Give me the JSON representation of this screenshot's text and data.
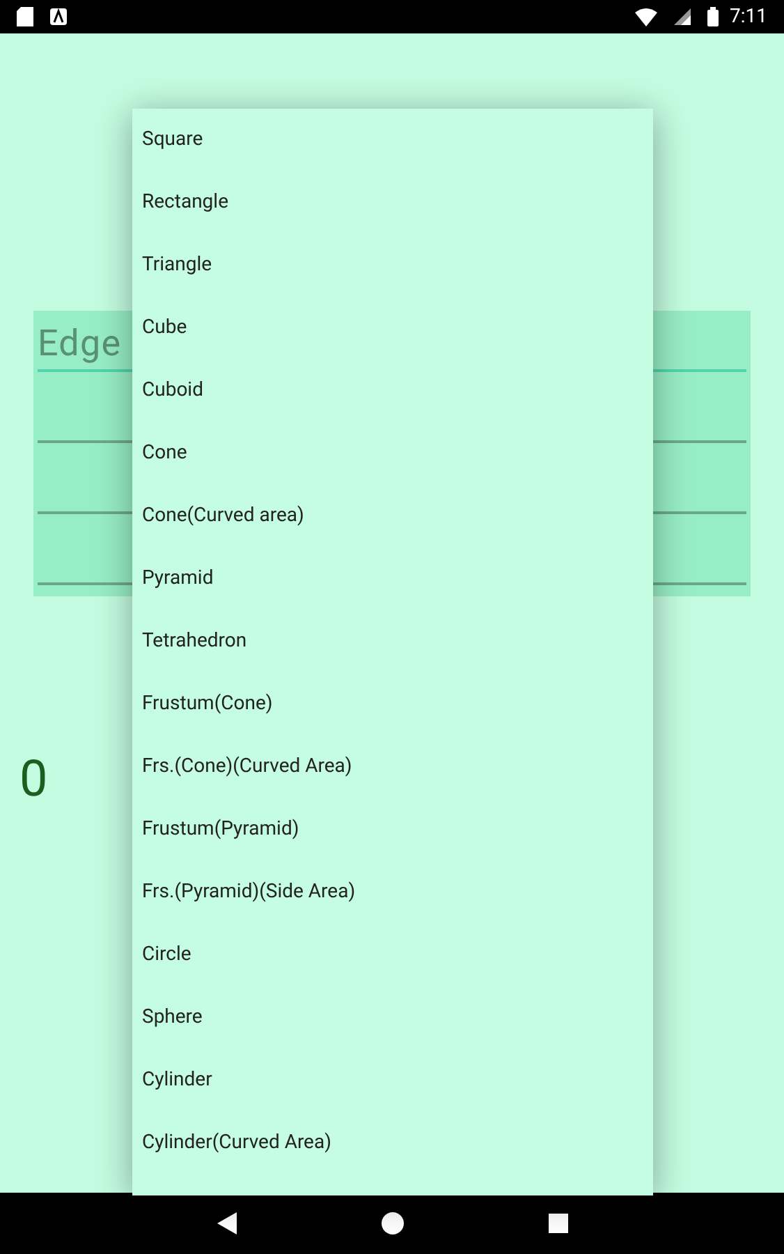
{
  "status_bar": {
    "time": "7:11"
  },
  "form": {
    "field": {
      "placeholder": "Edge"
    }
  },
  "result": "0",
  "menu": {
    "items": [
      "Square",
      "Rectangle",
      "Triangle",
      "Cube",
      "Cuboid",
      "Cone",
      "Cone(Curved area)",
      "Pyramid",
      "Tetrahedron",
      "Frustum(Cone)",
      "Frs.(Cone)(Curved Area)",
      "Frustum(Pyramid)",
      "Frs.(Pyramid)(Side Area)",
      "Circle",
      "Sphere",
      "Cylinder",
      "Cylinder(Curved Area)"
    ]
  }
}
